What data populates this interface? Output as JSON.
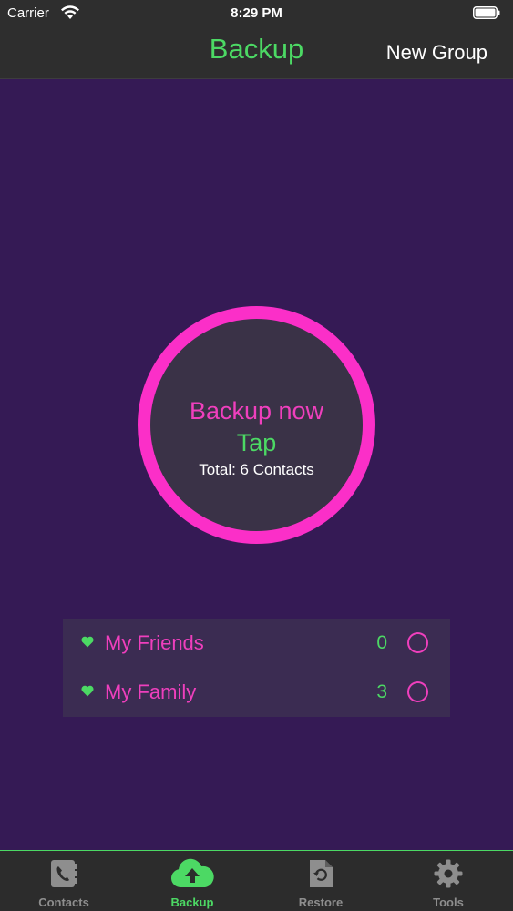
{
  "status_bar": {
    "carrier": "Carrier",
    "time": "8:29 PM",
    "icons": [
      "wifi-icon",
      "battery-icon"
    ]
  },
  "nav": {
    "title": "Backup",
    "right_button": "New Group"
  },
  "backup": {
    "title": "Backup now",
    "action": "Tap",
    "total": "Total: 6 Contacts"
  },
  "groups": [
    {
      "name": "My Friends",
      "count": "0",
      "icon": "heart-icon",
      "selected": false
    },
    {
      "name": "My Family",
      "count": "3",
      "icon": "heart-icon",
      "selected": false
    }
  ],
  "tabs": [
    {
      "label": "Contacts",
      "icon": "contacts-book-icon",
      "active": false
    },
    {
      "label": "Backup",
      "icon": "cloud-upload-icon",
      "active": true
    },
    {
      "label": "Restore",
      "icon": "restore-document-icon",
      "active": false
    },
    {
      "label": "Tools",
      "icon": "gear-icon",
      "active": false
    }
  ],
  "colors": {
    "background": "#351a55",
    "bar": "#2e2e2e",
    "accent_green": "#4cd964",
    "accent_pink": "#fb2fc8",
    "inactive_tab": "#8e8e8e"
  }
}
